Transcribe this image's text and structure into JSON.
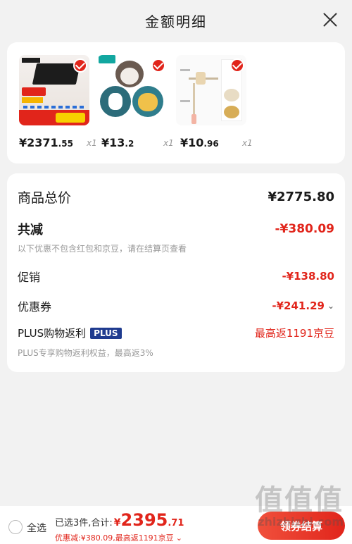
{
  "header": {
    "title": "金额明细"
  },
  "products": [
    {
      "price_int": "¥2371",
      "price_dec": ".55",
      "qty": "x1"
    },
    {
      "price_int": "¥13",
      "price_dec": ".2",
      "qty": "x1"
    },
    {
      "price_int": "¥10",
      "price_dec": ".96",
      "qty": "x1"
    }
  ],
  "details": {
    "total_label": "商品总价",
    "total_value": "¥2775.80",
    "discount_label": "共减",
    "discount_value": "-¥380.09",
    "discount_note": "以下优惠不包含红包和京豆，请在结算页查看",
    "promo_label": "促销",
    "promo_value": "-¥138.80",
    "coupon_label": "优惠券",
    "coupon_value": "-¥241.29",
    "plus_label": "PLUS购物返利",
    "plus_badge": "PLUS",
    "plus_value": "最高返1191京豆",
    "plus_note": "PLUS专享购物返利权益，最高返3%"
  },
  "bottom": {
    "select_all": "全选",
    "selected_text": "已选3件,合计:",
    "currency": "¥",
    "sum_int": "2395",
    "sum_dec": ".71",
    "sub_text": "优惠减:¥380.09,最高返1191京豆",
    "checkout": "领券结算"
  },
  "watermark": {
    "big": "值值值",
    "small": "zhizhizhi.com"
  },
  "colors": {
    "accent": "#e1251b",
    "plus_badge": "#1f3b8f"
  },
  "icons": [
    "close-icon",
    "check-icon",
    "chevron-down-icon",
    "radio-icon"
  ]
}
